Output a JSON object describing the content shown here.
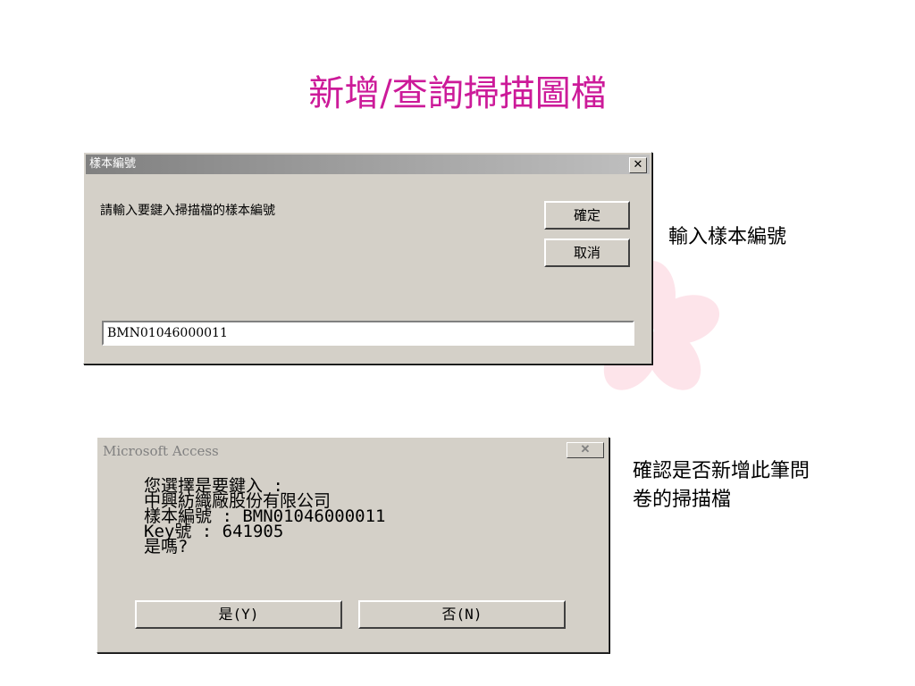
{
  "slide": {
    "title": "新增/查詢掃描圖檔"
  },
  "dialog1": {
    "title": "樣本編號",
    "close_glyph": "✕",
    "prompt": "請輸入要鍵入掃描檔的樣本編號",
    "ok_label": "確定",
    "cancel_label": "取消",
    "input_value": "BMN01046000011"
  },
  "caption1": "輸入樣本編號",
  "dialog2": {
    "title": "Microsoft Access",
    "close_glyph": "✕",
    "lines": [
      "您選擇是要鍵入 :",
      "中興紡織廠股份有限公司",
      "樣本編號 : BMN01046000011",
      "Key號 : 641905",
      "是嗎?"
    ],
    "yes_label": "是(Y)",
    "no_label": "否(N)"
  },
  "caption2": [
    "確認是否新增此筆問",
    "卷的掃描檔"
  ]
}
